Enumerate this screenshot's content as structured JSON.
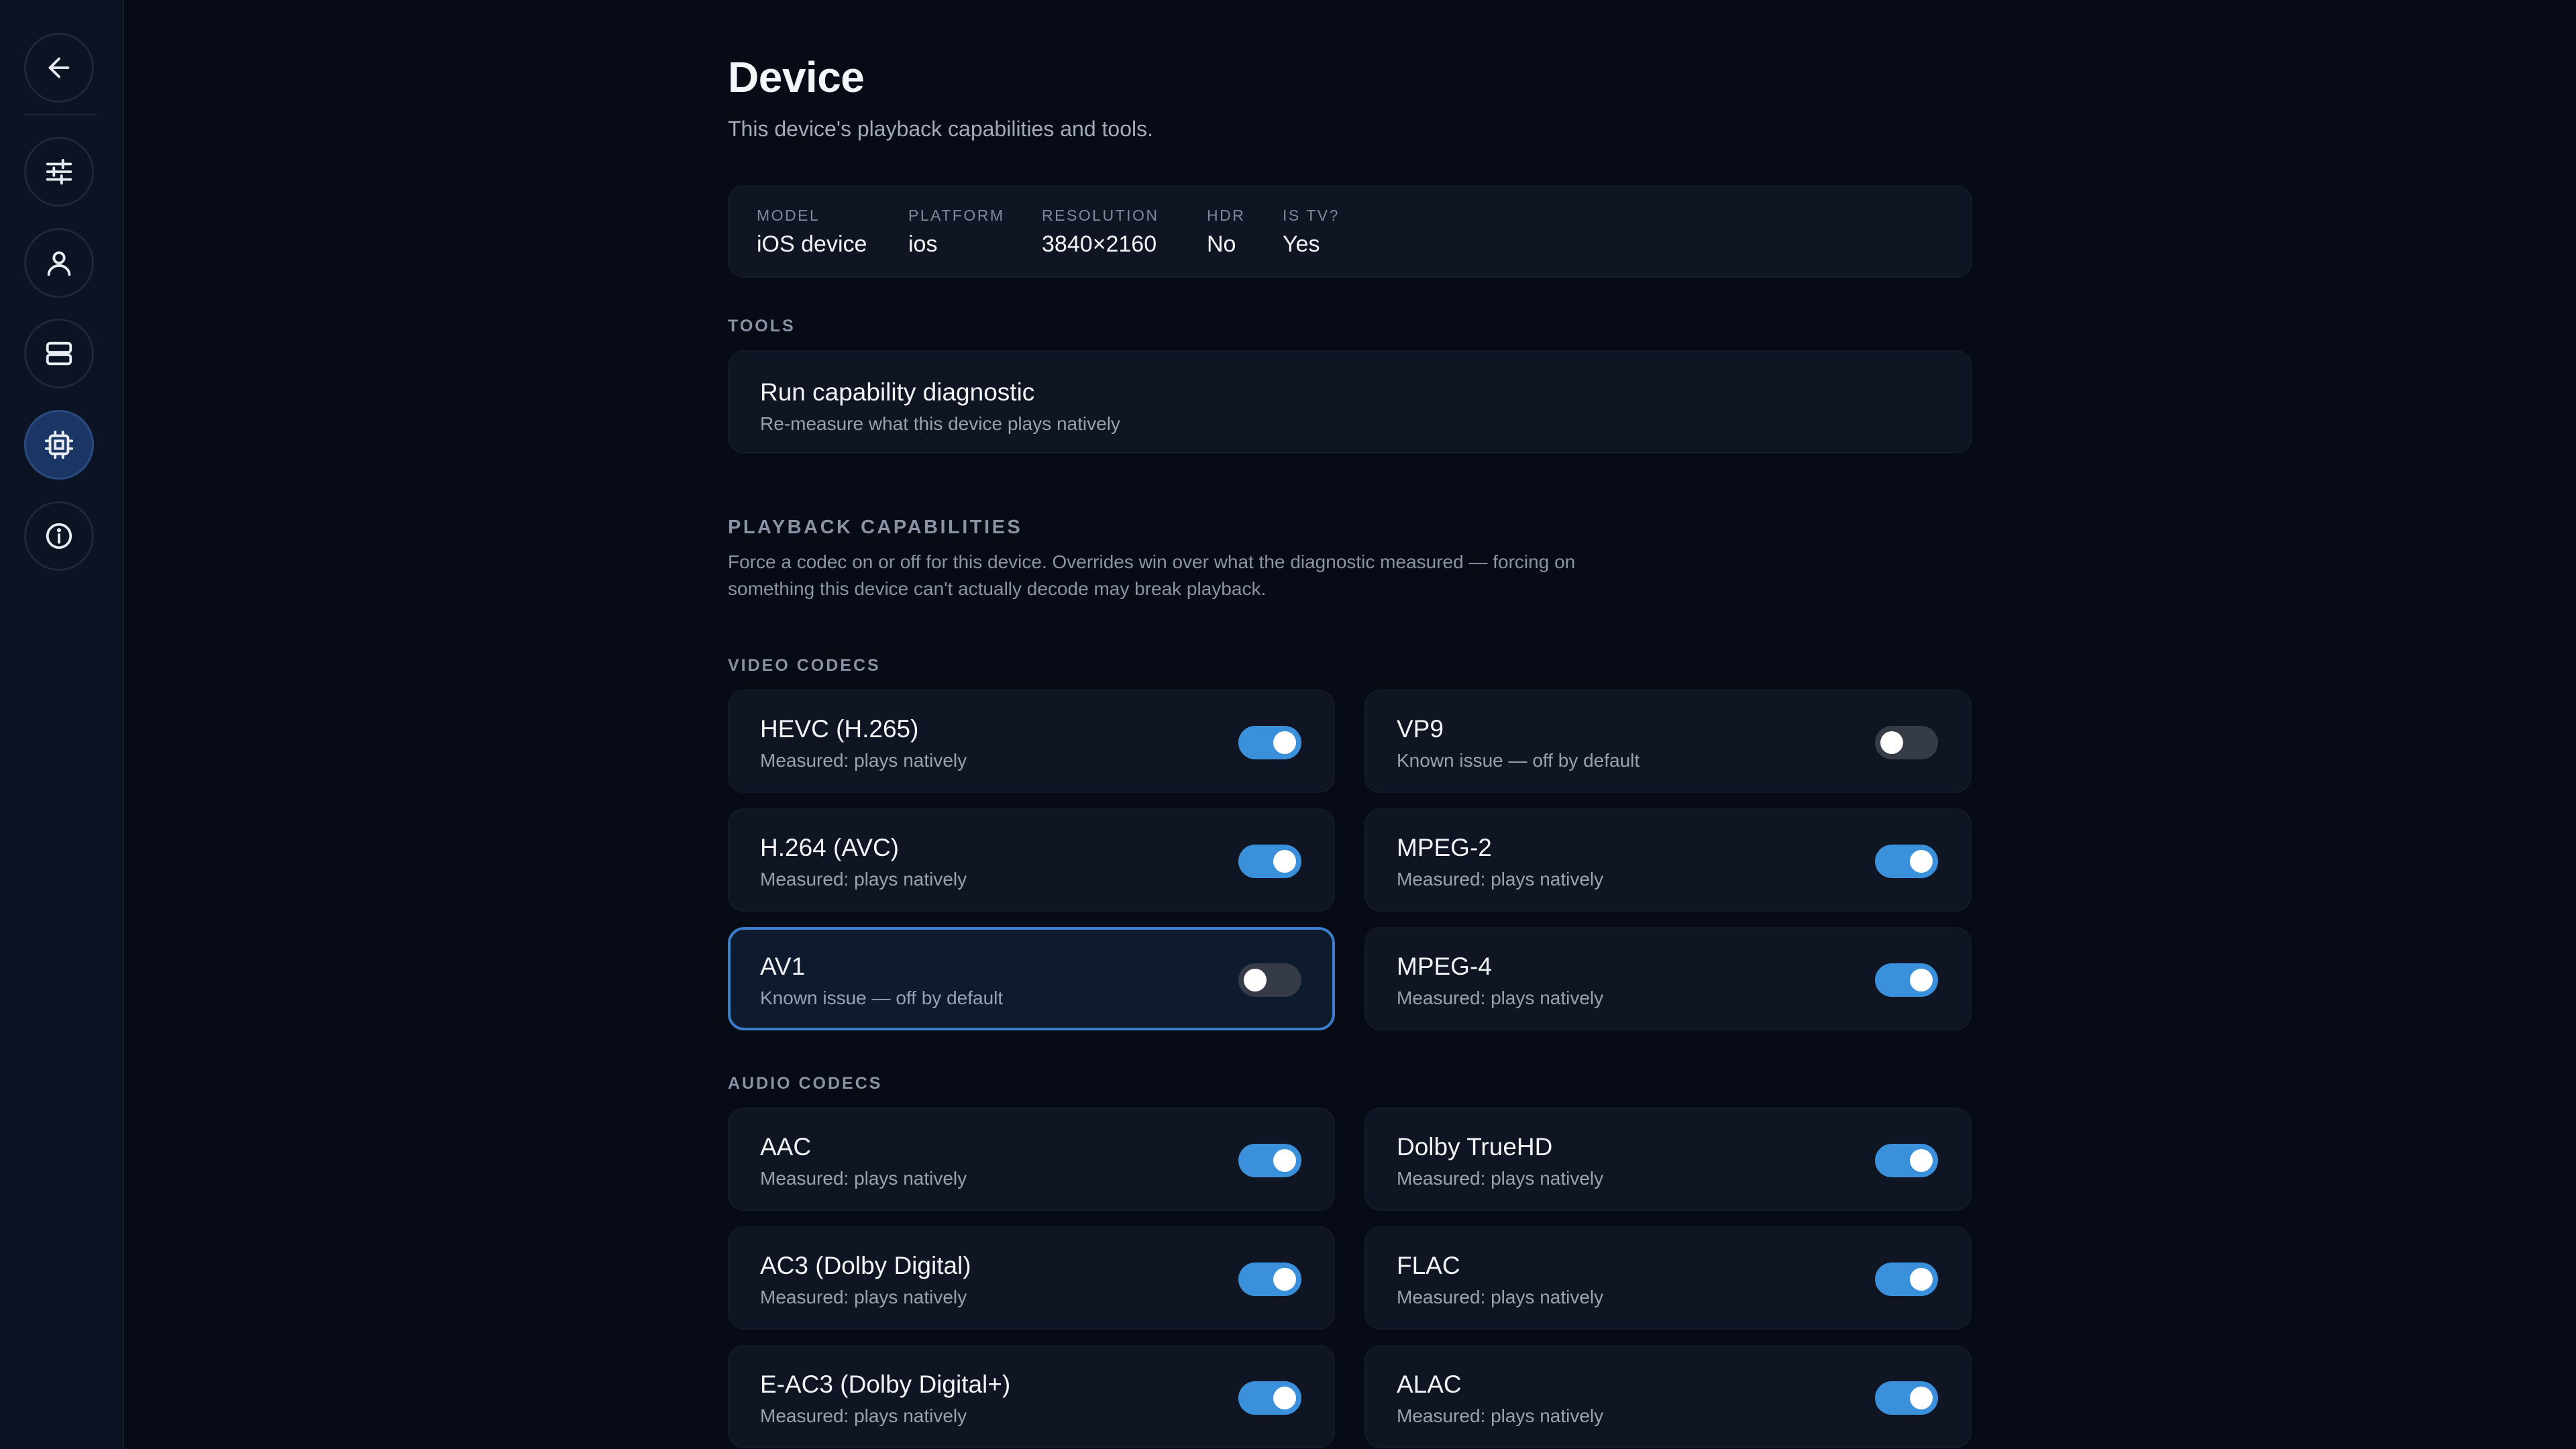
{
  "sidebar": {
    "items": [
      {
        "icon": "back-arrow-icon",
        "active": false
      },
      {
        "icon": "sliders-icon",
        "active": false
      },
      {
        "icon": "user-icon",
        "active": false
      },
      {
        "icon": "server-icon",
        "active": false
      },
      {
        "icon": "chip-icon",
        "active": true
      },
      {
        "icon": "info-icon",
        "active": false
      }
    ]
  },
  "header": {
    "title": "Device",
    "subtitle": "This device's playback capabilities and tools."
  },
  "device_info": [
    {
      "label": "MODEL",
      "value": "iOS device"
    },
    {
      "label": "PLATFORM",
      "value": "ios"
    },
    {
      "label": "RESOLUTION",
      "value": "3840×2160"
    },
    {
      "label": "HDR",
      "value": "No"
    },
    {
      "label": "IS TV?",
      "value": "Yes"
    }
  ],
  "tools": {
    "label": "TOOLS",
    "diagnostic": {
      "title": "Run capability diagnostic",
      "subtitle": "Re-measure what this device plays natively"
    }
  },
  "playback": {
    "label": "PLAYBACK CAPABILITIES",
    "description": "Force a codec on or off for this device. Overrides win over what the diagnostic measured — forcing on something this device can't actually decode may break playback."
  },
  "video_codecs": {
    "label": "VIDEO CODECS",
    "items": [
      {
        "name": "HEVC (H.265)",
        "status": "Measured: plays natively",
        "enabled": true
      },
      {
        "name": "VP9",
        "status": "Known issue — off by default",
        "enabled": false
      },
      {
        "name": "H.264 (AVC)",
        "status": "Measured: plays natively",
        "enabled": true
      },
      {
        "name": "MPEG-2",
        "status": "Measured: plays natively",
        "enabled": true
      },
      {
        "name": "AV1",
        "status": "Known issue — off by default",
        "enabled": false,
        "focused": true
      },
      {
        "name": "MPEG-4",
        "status": "Measured: plays natively",
        "enabled": true
      }
    ]
  },
  "audio_codecs": {
    "label": "AUDIO CODECS",
    "items": [
      {
        "name": "AAC",
        "status": "Measured: plays natively",
        "enabled": true
      },
      {
        "name": "Dolby TrueHD",
        "status": "Measured: plays natively",
        "enabled": true
      },
      {
        "name": "AC3 (Dolby Digital)",
        "status": "Measured: plays natively",
        "enabled": true
      },
      {
        "name": "FLAC",
        "status": "Measured: plays natively",
        "enabled": true
      },
      {
        "name": "E-AC3 (Dolby Digital+)",
        "status": "Measured: plays natively",
        "enabled": true
      },
      {
        "name": "ALAC",
        "status": "Measured: plays natively",
        "enabled": true
      }
    ]
  },
  "colors": {
    "accent": "#3b90dc",
    "focus_border": "#3d7ecb",
    "active_nav": "#1b3564",
    "background": "#070b15",
    "card": "#0f1522"
  }
}
